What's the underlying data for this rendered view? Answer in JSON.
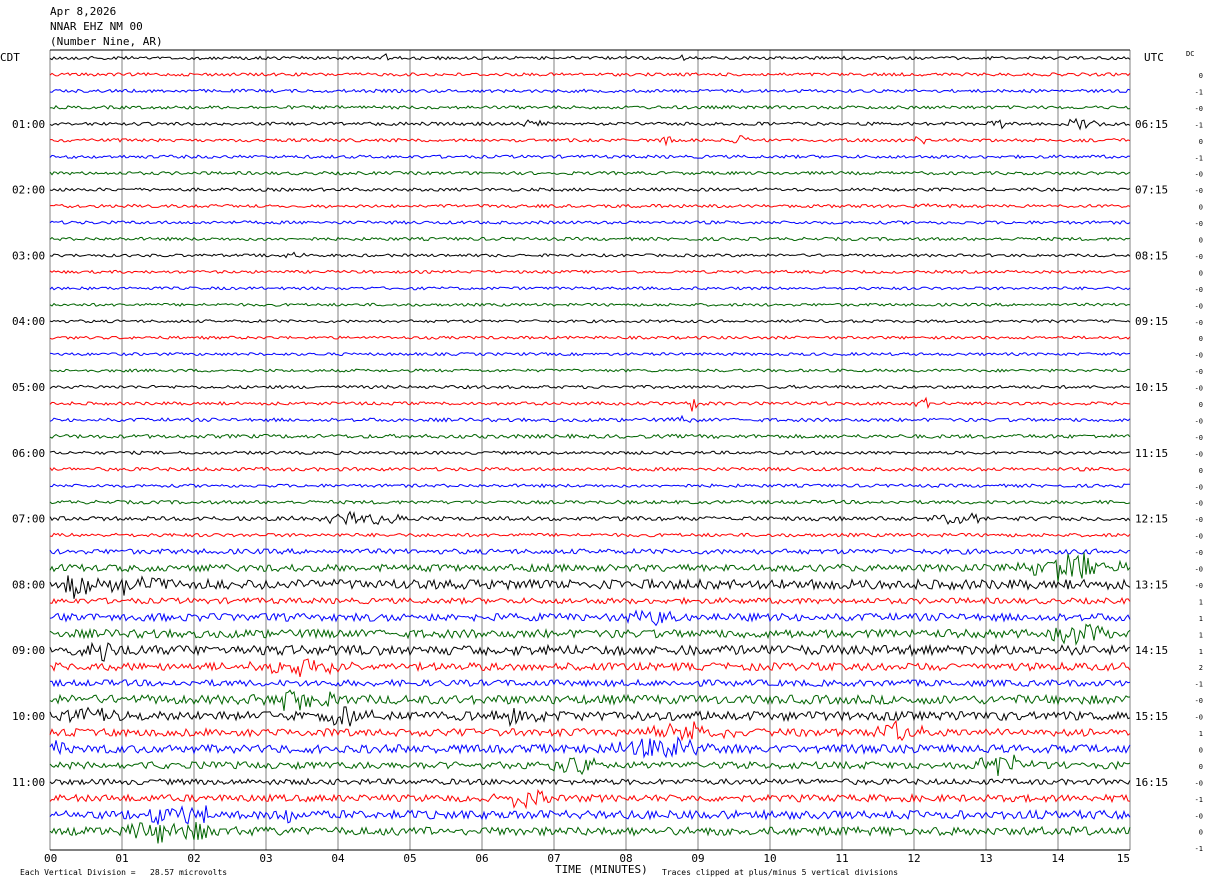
{
  "chart_data": {
    "type": "line",
    "title": [
      "Apr 8,2026",
      "NNAR EHZ NM 00",
      "(Number Nine, AR)"
    ],
    "left_axis_label": "CDT",
    "right_axis_label": "UTC",
    "dc_label": "DC",
    "xlabel": "TIME (MINUTES)",
    "xlim": [
      0,
      15
    ],
    "x_ticks": [
      "00",
      "01",
      "02",
      "03",
      "04",
      "05",
      "06",
      "07",
      "08",
      "09",
      "10",
      "11",
      "12",
      "13",
      "14",
      "15"
    ],
    "left_hour_labels": [
      {
        "row": 4,
        "label": "01:00"
      },
      {
        "row": 8,
        "label": "02:00"
      },
      {
        "row": 12,
        "label": "03:00"
      },
      {
        "row": 16,
        "label": "04:00"
      },
      {
        "row": 20,
        "label": "05:00"
      },
      {
        "row": 24,
        "label": "06:00"
      },
      {
        "row": 28,
        "label": "07:00"
      },
      {
        "row": 32,
        "label": "08:00"
      },
      {
        "row": 36,
        "label": "09:00"
      },
      {
        "row": 40,
        "label": "10:00"
      },
      {
        "row": 44,
        "label": "11:00"
      }
    ],
    "right_hour_labels": [
      {
        "row": 4,
        "label": "06:15"
      },
      {
        "row": 8,
        "label": "07:15"
      },
      {
        "row": 12,
        "label": "08:15"
      },
      {
        "row": 16,
        "label": "09:15"
      },
      {
        "row": 20,
        "label": "10:15"
      },
      {
        "row": 24,
        "label": "11:15"
      },
      {
        "row": 28,
        "label": "12:15"
      },
      {
        "row": 32,
        "label": "13:15"
      },
      {
        "row": 36,
        "label": "14:15"
      },
      {
        "row": 40,
        "label": "15:15"
      },
      {
        "row": 44,
        "label": "16:15"
      }
    ],
    "dc_offsets": [
      "0",
      "-1",
      "-0",
      "-1",
      "0",
      "-1",
      "-0",
      "-0",
      "0",
      "-0",
      "0",
      "-0",
      "0",
      "-0",
      "-0",
      "-0",
      "0",
      "-0",
      "-0",
      "-0",
      "0",
      "-0",
      "-0",
      "-0",
      "0",
      "-0",
      "-0",
      "-0",
      "-0",
      "-0",
      "-0",
      "-0",
      "1",
      "1",
      "1",
      "1",
      "2",
      "-1",
      "-0",
      "-0",
      "1",
      "0",
      "0",
      "-0",
      "-1",
      "-0",
      "0",
      "-1"
    ],
    "series_colors": [
      "#000000",
      "#ff0000",
      "#0000ff",
      "#006400"
    ],
    "grid": true,
    "footer_scale": "Each Vertical Division =   28.57 microvolts",
    "footer_clip": "Traces clipped at plus/minus 5 vertical divisions",
    "trace_rows": 48,
    "trace_noise": [
      1.0,
      1.0,
      1.0,
      1.0,
      1.0,
      1.0,
      1.0,
      1.0,
      1.0,
      1.0,
      1.0,
      1.0,
      0.9,
      0.9,
      0.9,
      0.9,
      0.9,
      0.9,
      0.9,
      0.9,
      1.0,
      1.0,
      1.1,
      1.2,
      1.0,
      1.1,
      1.0,
      1.1,
      1.3,
      1.1,
      1.6,
      2.2,
      3.0,
      1.8,
      2.4,
      2.6,
      3.0,
      2.4,
      2.0,
      2.8,
      2.8,
      2.4,
      2.6,
      2.2,
      1.8,
      2.2,
      2.6,
      2.6
    ],
    "events": [
      {
        "row": 0,
        "t": 4.65,
        "amp": 4,
        "dur": 0.06
      },
      {
        "row": 0,
        "t": 8.8,
        "amp": 3,
        "dur": 0.08
      },
      {
        "row": 4,
        "t": 6.7,
        "amp": 4,
        "dur": 0.2
      },
      {
        "row": 4,
        "t": 13.2,
        "amp": 4,
        "dur": 0.12
      },
      {
        "row": 4,
        "t": 14.3,
        "amp": 4,
        "dur": 0.3
      },
      {
        "row": 5,
        "t": 8.55,
        "amp": 6,
        "dur": 0.08
      },
      {
        "row": 5,
        "t": 9.6,
        "amp": 6,
        "dur": 0.08
      },
      {
        "row": 5,
        "t": 12.1,
        "amp": 6,
        "dur": 0.07
      },
      {
        "row": 9,
        "t": 1.2,
        "amp": 4,
        "dur": 0.05
      },
      {
        "row": 9,
        "t": 3.9,
        "amp": 4,
        "dur": 0.05
      },
      {
        "row": 9,
        "t": 12.15,
        "amp": 4,
        "dur": 0.07
      },
      {
        "row": 12,
        "t": 3.4,
        "amp": 3,
        "dur": 0.2
      },
      {
        "row": 21,
        "t": 8.9,
        "amp": 9,
        "dur": 0.12
      },
      {
        "row": 21,
        "t": 12.1,
        "amp": 8,
        "dur": 0.12
      },
      {
        "row": 22,
        "t": 8.8,
        "amp": 4,
        "dur": 0.2
      },
      {
        "row": 28,
        "t": 4.3,
        "amp": 7,
        "dur": 0.5
      },
      {
        "row": 28,
        "t": 12.6,
        "amp": 7,
        "dur": 0.35
      },
      {
        "row": 31,
        "t": 14.2,
        "amp": 14,
        "dur": 0.6
      },
      {
        "row": 32,
        "t": 0.4,
        "amp": 12,
        "dur": 0.25
      },
      {
        "row": 32,
        "t": 1.2,
        "amp": 8,
        "dur": 0.5
      },
      {
        "row": 34,
        "t": 8.4,
        "amp": 8,
        "dur": 0.35
      },
      {
        "row": 35,
        "t": 14.3,
        "amp": 9,
        "dur": 0.4
      },
      {
        "row": 36,
        "t": 0.7,
        "amp": 10,
        "dur": 0.3
      },
      {
        "row": 37,
        "t": 3.5,
        "amp": 7,
        "dur": 0.6
      },
      {
        "row": 39,
        "t": 3.5,
        "amp": 10,
        "dur": 0.5
      },
      {
        "row": 40,
        "t": 0.5,
        "amp": 9,
        "dur": 0.3
      },
      {
        "row": 40,
        "t": 4.1,
        "amp": 8,
        "dur": 0.4
      },
      {
        "row": 40,
        "t": 6.5,
        "amp": 9,
        "dur": 0.35
      },
      {
        "row": 41,
        "t": 8.9,
        "amp": 8,
        "dur": 0.5
      },
      {
        "row": 41,
        "t": 11.8,
        "amp": 10,
        "dur": 0.3
      },
      {
        "row": 42,
        "t": 0.1,
        "amp": 9,
        "dur": 0.1
      },
      {
        "row": 42,
        "t": 8.5,
        "amp": 9,
        "dur": 0.6
      },
      {
        "row": 43,
        "t": 7.2,
        "amp": 10,
        "dur": 0.4
      },
      {
        "row": 43,
        "t": 13.2,
        "amp": 10,
        "dur": 0.4
      },
      {
        "row": 45,
        "t": 6.6,
        "amp": 9,
        "dur": 0.3
      },
      {
        "row": 46,
        "t": 1.8,
        "amp": 10,
        "dur": 0.5
      },
      {
        "row": 46,
        "t": 3.3,
        "amp": 9,
        "dur": 0.15
      },
      {
        "row": 47,
        "t": 1.7,
        "amp": 14,
        "dur": 0.5
      }
    ]
  }
}
